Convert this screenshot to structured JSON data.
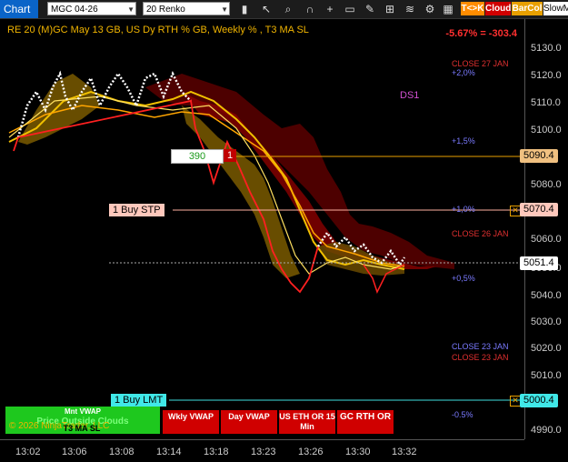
{
  "toolbar": {
    "tab": "Chart",
    "instrument": "MGC 04-26",
    "bar_type": "20 Renko",
    "btn_tk": "T<>K",
    "btn_cloud": "Cloud",
    "btn_barcol": "BarCol",
    "btn_slowm": "SlowM"
  },
  "chart": {
    "title": "RE 20  (M)GC May 13 GB, US Dy RTH % GB, Weekly % , T3 MA SL",
    "performance": "-5.67% = -303.4",
    "ds1": "DS1",
    "copyright": "© 2026 NinjaTrader, LLC",
    "watermark": "Price Outside Clouds",
    "y_ticks": [
      "5130.0",
      "5120.0",
      "5110.0",
      "5100.0",
      "5080.0",
      "5060.0",
      "5050.0",
      "5040.0",
      "5030.0",
      "5020.0",
      "5010.0",
      "4990.0"
    ],
    "x_ticks": [
      "13:02",
      "13:06",
      "13:08",
      "13:14",
      "13:18",
      "13:23",
      "13:26",
      "13:30",
      "13:32"
    ],
    "price_boxes": {
      "p5090": "5090.4",
      "p5070": "5070.4",
      "p5051": "5051.4",
      "p5000": "5000.4"
    },
    "annotations": {
      "close27": "CLOSE 27 JAN",
      "plus2": "+2,0%",
      "plus15": "+1,5%",
      "plus1": "+1,0%",
      "close26": "CLOSE 26 JAN",
      "plus05": "+0,5%",
      "close23a": "CLOSE 23 JAN",
      "close23b": "CLOSE 23 JAN",
      "minus05": "-0.5%"
    },
    "orders": {
      "buy_stp": "1 Buy STP",
      "buy_lmt": "1 Buy LMT",
      "qty": "390",
      "qty_count": "1"
    },
    "buttons": {
      "mnt_vwap": "Mnt VWAP",
      "t3_ma_sl": "T3 MA SL",
      "wkly_vwap": "Wkly VWAP",
      "day_vwap": "Day VWAP",
      "us_eth_or": "US ETH OR 15 Min",
      "gc_rth_or": "GC RTH OR"
    }
  }
}
